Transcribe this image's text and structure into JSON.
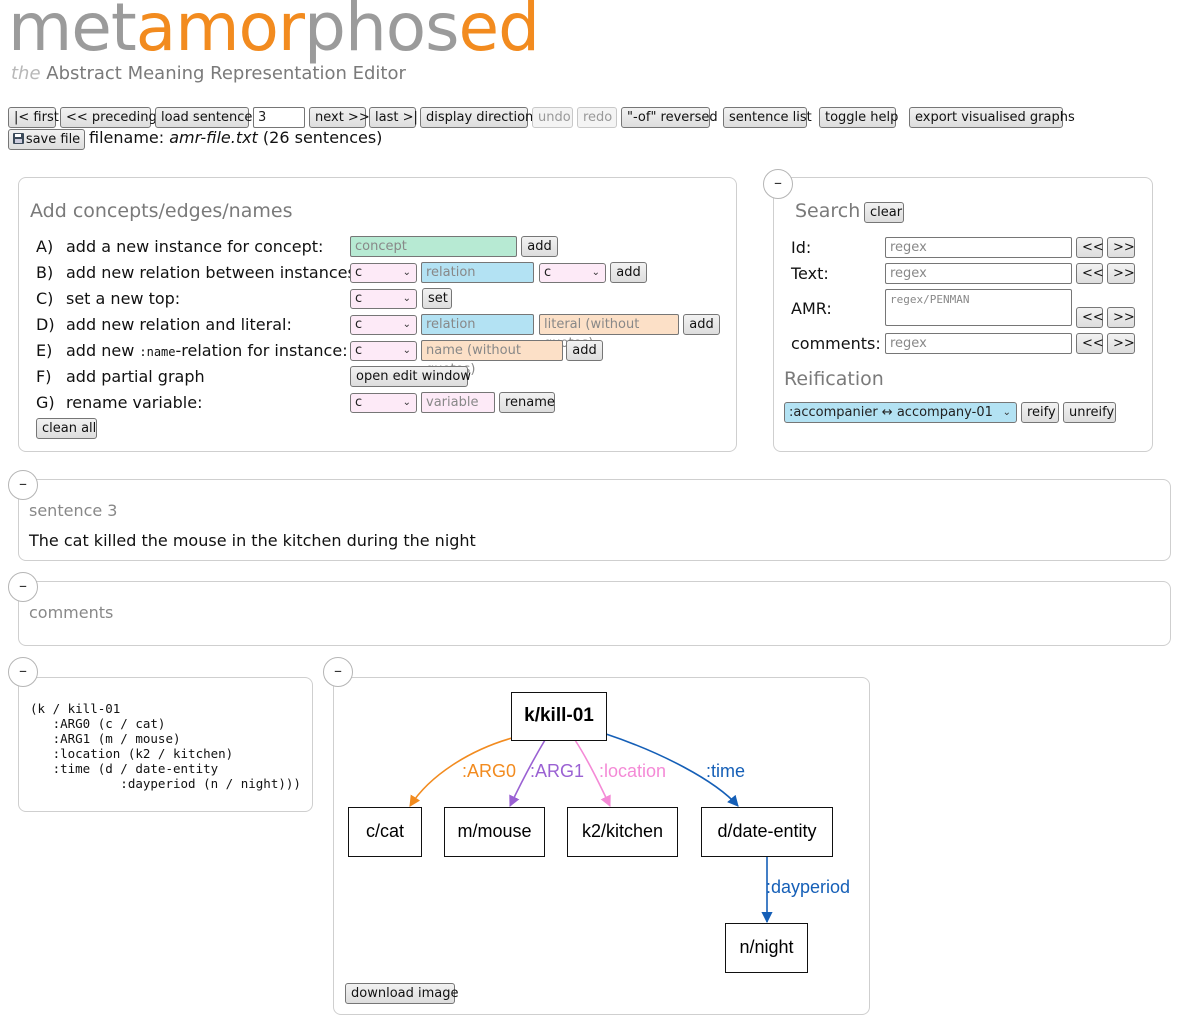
{
  "header": {
    "logo_part1": "met",
    "logo_part2": "amor",
    "logo_part3": "phos",
    "logo_part4": "ed",
    "subtitle_the": "the",
    "subtitle_rest": "Abstract Meaning Representation Editor"
  },
  "toolbar": {
    "first": "|< first",
    "preceding": "<< preceding",
    "load_sentence": "load sentence",
    "sentence_number": "3",
    "next": "next >>",
    "last": "last >|",
    "display_direction": "display direction",
    "undo": "undo",
    "redo": "redo",
    "of_reversed": "\"-of\" reversed",
    "sentence_list": "sentence list",
    "toggle_help": "toggle help",
    "export_graphs": "export visualised graphs",
    "save_file": "save file",
    "save_icon": "floppy-disk-icon",
    "filename_label": "filename:",
    "filename": "amr-file.txt",
    "sentence_count": "(26 sentences)"
  },
  "add_panel": {
    "title": "Add concepts/edges/names",
    "rows": [
      {
        "letter": "A)",
        "label": "add a new instance for concept:"
      },
      {
        "letter": "B)",
        "label": "add new relation between instances:"
      },
      {
        "letter": "C)",
        "label": "set a new top:"
      },
      {
        "letter": "D)",
        "label": "add new relation and literal:"
      },
      {
        "letter": "E)",
        "label_pre": "add new",
        "label_code": ":name",
        "label_post": "-relation for instance:"
      },
      {
        "letter": "F)",
        "label": "add partial graph"
      },
      {
        "letter": "G)",
        "label": "rename variable:"
      }
    ],
    "concept_placeholder": "concept",
    "relation_placeholder": "relation",
    "literal_placeholder": "literal (without quotes)",
    "name_placeholder": "name (without quotes)",
    "variable_placeholder": "variable",
    "var_selected": "c",
    "add": "add",
    "set": "set",
    "open_edit_window": "open edit window",
    "rename": "rename",
    "clean_all": "clean all",
    "colors": {
      "concept": "#b7ead3",
      "relation": "#b3e2f3",
      "literal": "#fce0c7",
      "variable": "#fdeaf7"
    }
  },
  "search_panel": {
    "title": "Search",
    "clear": "clear",
    "fields": [
      {
        "label": "Id:",
        "placeholder": "regex"
      },
      {
        "label": "Text:",
        "placeholder": "regex"
      },
      {
        "label": "AMR:",
        "placeholder": "regex/PENMAN"
      },
      {
        "label": "comments:",
        "placeholder": "regex"
      }
    ],
    "prev": "<<",
    "next": ">>",
    "reification_title": "Reification",
    "reification_selected": ":accompanier ↔ accompany-01",
    "reify": "reify",
    "unreify": "unreify"
  },
  "sentence_panel": {
    "title": "sentence 3",
    "text": "The cat killed the mouse in the kitchen during the night"
  },
  "comments_panel": {
    "title": "comments"
  },
  "penman": {
    "text": "(k / kill-01\n   :ARG0 (c / cat)\n   :ARG1 (m / mouse)\n   :location (k2 / kitchen)\n   :time (d / date-entity\n            :dayperiod (n / night)))"
  },
  "graph": {
    "top": "k/kill-01",
    "nodes": [
      "c/cat",
      "m/mouse",
      "k2/kitchen",
      "d/date-entity",
      "n/night"
    ],
    "edges": [
      {
        "label": ":ARG0",
        "color": "#f28b1f"
      },
      {
        "label": ":ARG1",
        "color": "#9a61d3"
      },
      {
        "label": ":location",
        "color": "#f48ad6"
      },
      {
        "label": ":time",
        "color": "#155fb7"
      },
      {
        "label": ":dayperiod",
        "color": "#155fb7"
      }
    ],
    "download_image": "download image"
  },
  "collapse_symbol": "–"
}
